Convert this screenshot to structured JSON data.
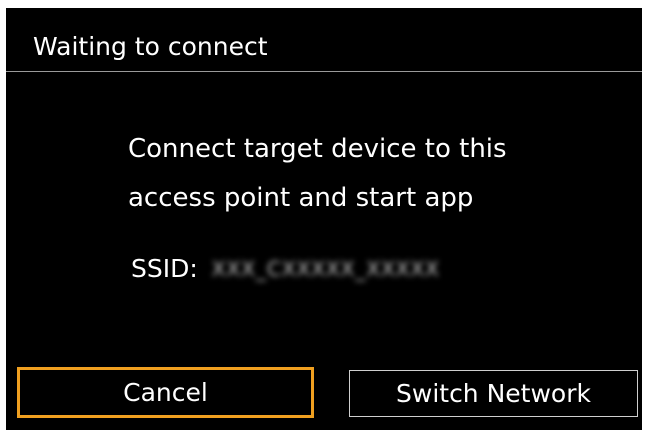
{
  "header": {
    "title": "Waiting to connect"
  },
  "message": {
    "line1": "Connect target device to this",
    "line2": "access point and start app"
  },
  "ssid": {
    "label": "SSID:",
    "value": "XXX_CXXXXX_XXXXX"
  },
  "buttons": {
    "cancel_label": "Cancel",
    "switch_network_label": "Switch Network"
  },
  "colors": {
    "background": "#000000",
    "text": "#ffffff",
    "focus_border": "#f0a020",
    "button_border": "#cfcfcf",
    "divider": "#9a9a9a"
  }
}
